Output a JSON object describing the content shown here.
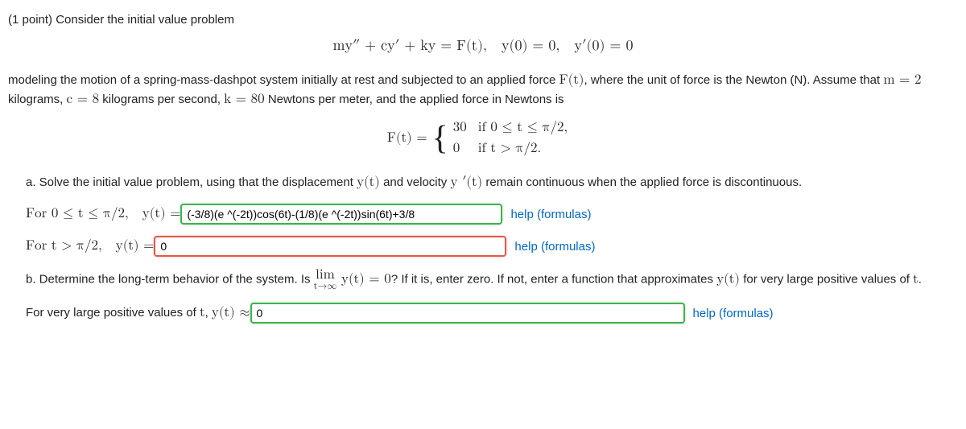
{
  "header": {
    "points": "(1 point) Consider the initial value problem"
  },
  "eq_main": "my″ + cy′ + ky = F(t), y(0) = 0, y′(0) = 0",
  "para1_a": "modeling the motion of a spring-mass-dashpot system initially at rest and subjected to an applied force ",
  "para1_Ft": "F(t)",
  "para1_b": ", where the unit of force is the Newton (N). Assume that ",
  "para1_m": "m = 2",
  "para1_c": " kilograms, ",
  "para1_cvar": "c = 8",
  "para1_d": " kilograms per second, ",
  "para1_k": "k = 80",
  "para1_e": " Newtons per meter, and the applied force in Newtons is",
  "piecewise": {
    "lhs": "F(t) = ",
    "r1v": "30",
    "r1c": "if 0 ≤ t ≤ π/2,",
    "r2v": "0",
    "r2c": "if t > π/2."
  },
  "part_a": {
    "label": "a. Solve the initial value problem, using that the displacement ",
    "yt": "y(t)",
    "mid": " and velocity ",
    "ypt": "y ′(t)",
    "tail": " remain continuous when the applied force is discontinuous."
  },
  "row1": {
    "prefix": "For 0 ≤ t ≤ π/2, y(t) = ",
    "value": "(-3/8)(e ^(-2t))cos(6t)-(1/8)(e ^(-2t))sin(6t)+3/8"
  },
  "row2": {
    "prefix": "For t > π/2, y(t) = ",
    "value": "0"
  },
  "part_b": {
    "label_a": "b. Determine the long-term behavior of the system. Is ",
    "lim_top": "lim",
    "lim_bot": "t→∞",
    "lim_arg": " y(t) = 0",
    "label_b": "? If it is, enter zero. If not, enter a function that approximates ",
    "yt": "y(t)",
    "label_c": " for very large positive values of ",
    "tvar": "t",
    "label_d": "."
  },
  "row3": {
    "prefix_a": "For very large positive values of ",
    "tvar": "t",
    "prefix_b": ", ",
    "yt_approx": "y(t) ≈ ",
    "value": "0"
  },
  "help": "help (formulas)"
}
